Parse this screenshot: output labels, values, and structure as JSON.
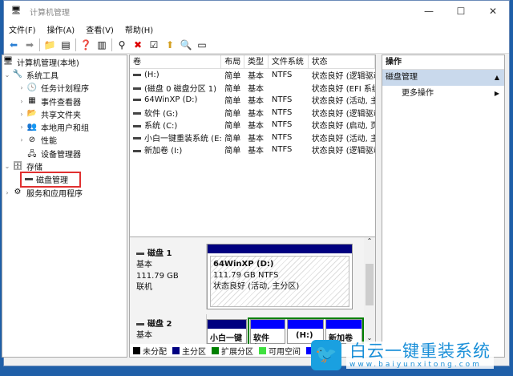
{
  "window": {
    "title": "计算机管理",
    "minimize": "—",
    "maximize": "☐",
    "close": "✕"
  },
  "menu": [
    "文件(F)",
    "操作(A)",
    "查看(V)",
    "帮助(H)"
  ],
  "tree": {
    "root": "计算机管理(本地)",
    "system_tools": "系统工具",
    "items": [
      "任务计划程序",
      "事件查看器",
      "共享文件夹",
      "本地用户和组",
      "性能",
      "设备管理器"
    ],
    "storage": "存储",
    "disk_mgmt": "磁盘管理",
    "services": "服务和应用程序"
  },
  "table": {
    "headers": [
      "卷",
      "布局",
      "类型",
      "文件系统",
      "状态"
    ],
    "rows": [
      [
        "(H:)",
        "简单",
        "基本",
        "NTFS",
        "状态良好 (逻辑驱动"
      ],
      [
        "(磁盘 0 磁盘分区 1)",
        "简单",
        "基本",
        "",
        "状态良好 (EFI 系统"
      ],
      [
        "64WinXP  (D:)",
        "简单",
        "基本",
        "NTFS",
        "状态良好 (活动, 主"
      ],
      [
        "软件 (G:)",
        "简单",
        "基本",
        "NTFS",
        "状态良好 (逻辑驱动"
      ],
      [
        "系统 (C:)",
        "简单",
        "基本",
        "NTFS",
        "状态良好 (启动, 页"
      ],
      [
        "小白一键重装系统 (E:)",
        "简单",
        "基本",
        "NTFS",
        "状态良好 (活动, 主"
      ],
      [
        "新加卷 (I:)",
        "简单",
        "基本",
        "NTFS",
        "状态良好 (逻辑驱动"
      ]
    ]
  },
  "disk1": {
    "name": "磁盘 1",
    "type": "基本",
    "size": "111.79 GB",
    "status": "联机",
    "part": {
      "name": "64WinXP    (D:)",
      "size": "111.79 GB NTFS",
      "state": "状态良好 (活动, 主分区)"
    }
  },
  "disk2": {
    "name": "磁盘 2",
    "type": "基本",
    "parts": [
      "小白一键",
      "软件 (G",
      "(H:)",
      "新加卷"
    ]
  },
  "legend": [
    {
      "label": "未分配",
      "color": "#000000"
    },
    {
      "label": "主分区",
      "color": "#000080"
    },
    {
      "label": "扩展分区",
      "color": "#008000"
    },
    {
      "label": "可用空间",
      "color": "#40e040"
    },
    {
      "label": "",
      "color": "#0000ff"
    }
  ],
  "actions": {
    "header": "操作",
    "section": "磁盘管理",
    "more": "更多操作"
  },
  "watermark": {
    "brand": "白云一键重装系统",
    "url": "www.baiyunxitong.com"
  }
}
